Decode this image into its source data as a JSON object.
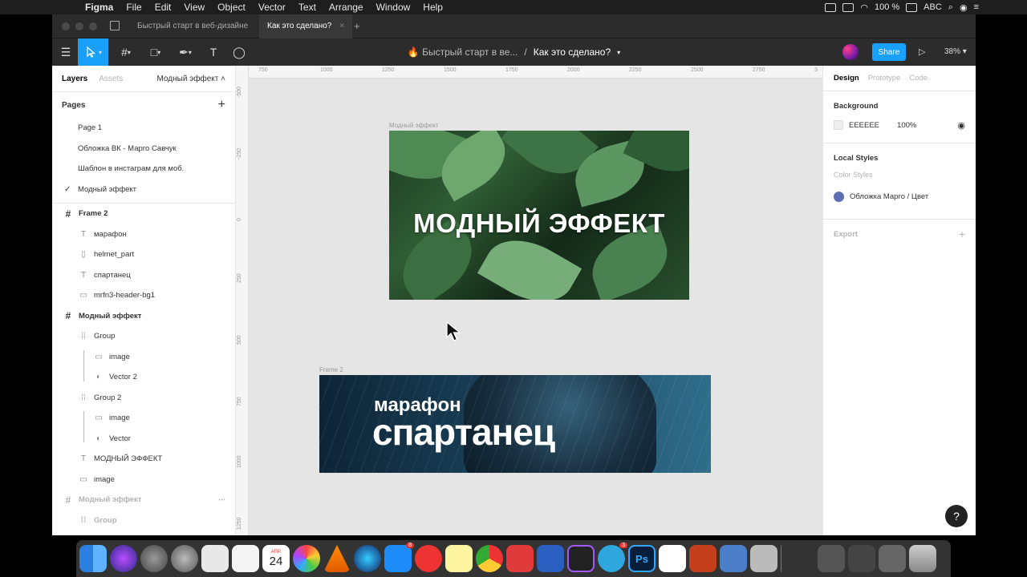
{
  "menubar": {
    "app": "Figma",
    "items": [
      "File",
      "Edit",
      "View",
      "Object",
      "Vector",
      "Text",
      "Arrange",
      "Window",
      "Help"
    ],
    "battery": "100 %",
    "input": "ABC"
  },
  "tabs": [
    {
      "label": "Быстрый старт в веб-дизайне",
      "active": false
    },
    {
      "label": "Как это сделано?",
      "active": true
    }
  ],
  "toolbar": {
    "breadcrumb_project": "🔥 Быстрый старт в ве...",
    "breadcrumb_sep": "/",
    "breadcrumb_file": "Как это сделано?",
    "share_label": "Share",
    "zoom": "38%"
  },
  "left_panel": {
    "tab_layers": "Layers",
    "tab_assets": "Assets",
    "current_page": "Модный эффект",
    "pages_heading": "Pages",
    "pages": [
      "Page 1",
      "Обложка ВК - Марго Савчук",
      "Шаблон в инстаграм для моб.",
      "Модный эффект"
    ],
    "selected_page_index": 3,
    "layers": [
      {
        "name": "Frame 2",
        "icon": "frame",
        "depth": 0
      },
      {
        "name": "марафон",
        "icon": "text",
        "depth": 1
      },
      {
        "name": "helmet_part",
        "icon": "image",
        "depth": 1
      },
      {
        "name": "спартанец",
        "icon": "text",
        "depth": 1
      },
      {
        "name": "mrfn3-header-bg1",
        "icon": "rect",
        "depth": 1
      },
      {
        "name": "Модный эффект",
        "icon": "frame",
        "depth": 0
      },
      {
        "name": "Group",
        "icon": "group",
        "depth": 1
      },
      {
        "name": "image",
        "icon": "rect",
        "depth": 2
      },
      {
        "name": "Vector 2",
        "icon": "mask",
        "depth": 2
      },
      {
        "name": "Group 2",
        "icon": "group",
        "depth": 1
      },
      {
        "name": "image",
        "icon": "rect",
        "depth": 2
      },
      {
        "name": "Vector",
        "icon": "mask",
        "depth": 2
      },
      {
        "name": "МОДНЫЙ ЭФФЕКТ",
        "icon": "text",
        "depth": 1
      },
      {
        "name": "image",
        "icon": "rect",
        "depth": 1
      },
      {
        "name": "Модный эффект",
        "icon": "frame",
        "depth": 0,
        "dim": true
      },
      {
        "name": "Group",
        "icon": "group",
        "depth": 1,
        "dim": true
      }
    ]
  },
  "canvas": {
    "ruler_top": [
      "750",
      "1000",
      "1250",
      "1500",
      "1750",
      "2000",
      "2250",
      "2500",
      "2750",
      "3"
    ],
    "ruler_left": [
      "-500",
      "-250",
      "0",
      "250",
      "500",
      "750",
      "1000",
      "1250"
    ],
    "frame1_label": "Модный эффект",
    "frame1_title": "МОДНЫЙ ЭФФЕКТ",
    "frame2_label": "Frame 2",
    "frame2_line1": "марафон",
    "frame2_line2": "спартанец"
  },
  "right_panel": {
    "tab_design": "Design",
    "tab_prototype": "Prototype",
    "tab_code": "Code",
    "background_heading": "Background",
    "background_hex": "EEEEEE",
    "background_opacity": "100%",
    "local_styles_heading": "Local Styles",
    "color_styles_heading": "Color Styles",
    "style_name": "Обложка Марго / Цвет",
    "export_heading": "Export"
  },
  "dock": {
    "calendar_month": "АПР.",
    "calendar_day": "24",
    "badges": {
      "appstore": "8",
      "telegram": "3"
    },
    "ps_label": "Ps"
  },
  "colors": {
    "accent": "#18a0fb",
    "toolbar_bg": "#2c2c2c",
    "canvas_bg": "#e5e5e5",
    "style_color": "#5b6fb0"
  }
}
